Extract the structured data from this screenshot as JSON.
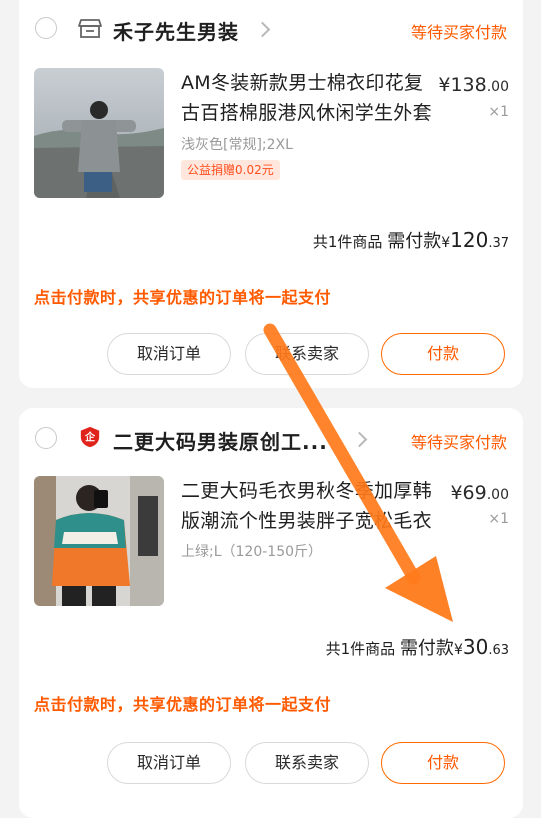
{
  "orders": [
    {
      "shop_name": "禾子先生男装",
      "status": "等待买家付款",
      "product_title": "AM冬装新款男士棉衣印花复古百搭棉服港风休闲学生外套",
      "sku": "浅灰色[常规];2XL",
      "tag": "公益捐赠0.02元",
      "price_main": "¥138",
      "price_dec": ".00",
      "qty": "×1",
      "summary_count": "共1件商品",
      "summary_label": "需付款",
      "summary_sym": "¥",
      "summary_main": "120",
      "summary_dec": ".37",
      "notice": "点击付款时，共享优惠的订单将一起支付",
      "btn_cancel": "取消订单",
      "btn_contact": "联系卖家",
      "btn_pay": "付款"
    },
    {
      "shop_name": "二更大码男装原创工...",
      "status": "等待买家付款",
      "product_title": "二更大码毛衣男秋冬季加厚韩版潮流个性男装胖子宽松毛衣",
      "sku": "上绿;L（120-150斤）",
      "price_main": "¥69",
      "price_dec": ".00",
      "qty": "×1",
      "summary_count": "共1件商品",
      "summary_label": "需付款",
      "summary_sym": "¥",
      "summary_main": "30",
      "summary_dec": ".63",
      "notice": "点击付款时，共享优惠的订单将一起支付",
      "btn_cancel": "取消订单",
      "btn_contact": "联系卖家",
      "btn_pay": "付款"
    }
  ],
  "icons": {
    "order1_shop": "store-icon",
    "order2_shop": "brand-shield-icon",
    "chevron": "chevron-right-icon"
  },
  "colors": {
    "accent": "#ff5a00",
    "annotation_arrow": "#ff7a1a"
  }
}
